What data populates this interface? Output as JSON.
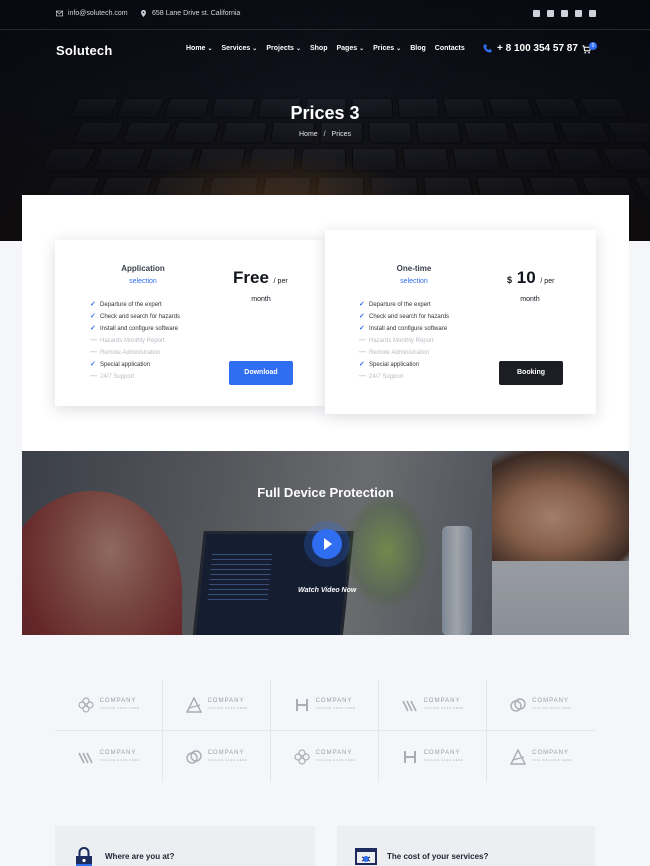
{
  "topbar": {
    "email": "info@solutech.com",
    "address": "658 Lane Drive st. California",
    "social": [
      "facebook-icon",
      "twitter-icon",
      "youtube-icon",
      "github-icon",
      "linkedin-icon"
    ]
  },
  "nav": {
    "logo": "Solutech",
    "menu": [
      {
        "label": "Home",
        "caret": true
      },
      {
        "label": "Services",
        "caret": true
      },
      {
        "label": "Projects",
        "caret": true
      },
      {
        "label": "Shop",
        "caret": false
      },
      {
        "label": "Pages",
        "caret": true
      },
      {
        "label": "Prices",
        "caret": true
      },
      {
        "label": "Blog",
        "caret": false
      },
      {
        "label": "Contacts",
        "caret": false
      }
    ],
    "phone": "+ 8 100 354 57 87",
    "cart_count": "0"
  },
  "hero": {
    "title": "Prices 3",
    "breadcrumb": [
      "Home",
      "/",
      "Prices"
    ]
  },
  "pricing": {
    "plans": [
      {
        "name": "Application",
        "subtitle": "selection",
        "price": "Free",
        "per": "/ per",
        "period": "month",
        "button": "Download",
        "features": [
          {
            "text": "Departure of the expert",
            "included": true
          },
          {
            "text": "Check and search for hazards",
            "included": true
          },
          {
            "text": "Install and configure software",
            "included": true
          },
          {
            "text": "Hazards Monthly Report",
            "included": false
          },
          {
            "text": "Remote Administration",
            "included": false
          },
          {
            "text": "Special application",
            "included": true
          },
          {
            "text": "24/7 Support",
            "included": false
          }
        ]
      },
      {
        "name": "One-time",
        "subtitle": "selection",
        "currency": "$",
        "price": "10",
        "per": "/ per",
        "period": "month",
        "button": "Booking",
        "features": [
          {
            "text": "Departure of the expert",
            "included": true
          },
          {
            "text": "Check and search for hazards",
            "included": true
          },
          {
            "text": "Install and configure software",
            "included": true
          },
          {
            "text": "Hazards Monthly Report",
            "included": false
          },
          {
            "text": "Remote Administration",
            "included": false
          },
          {
            "text": "Special application",
            "included": true
          },
          {
            "text": "24/7 Support",
            "included": false
          }
        ]
      }
    ]
  },
  "video": {
    "title": "Full Device Protection",
    "watch_label": "Watch Video Now"
  },
  "logos": {
    "company_text": "COMPANY",
    "tagline": "TAGLINE GOES HERE",
    "marks": [
      "flower",
      "triangle",
      "h-letter",
      "stripes",
      "rings",
      "stripes",
      "rings",
      "flower",
      "h-letter",
      "triangle"
    ]
  },
  "questions": [
    {
      "icon": "lock-icon",
      "text": "Where are you at?"
    },
    {
      "icon": "monitor-bug-icon",
      "text": "The cost of your services?"
    }
  ],
  "colors": {
    "accent": "#2f6ef0",
    "dark_button": "#1c1e24"
  }
}
